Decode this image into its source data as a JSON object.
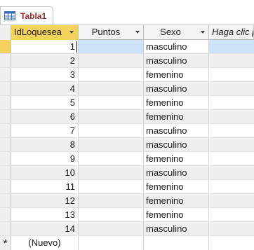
{
  "tab": {
    "title": "Tabla1",
    "icon": "table-icon"
  },
  "columns": [
    {
      "key": "id",
      "label": "IdLoquesea",
      "has_dropdown": true
    },
    {
      "key": "puntos",
      "label": "Puntos",
      "has_dropdown": true
    },
    {
      "key": "sexo",
      "label": "Sexo",
      "has_dropdown": true
    },
    {
      "key": "add",
      "label": "Haga clic p",
      "has_dropdown": false
    }
  ],
  "rows": [
    {
      "id": "1",
      "puntos": "",
      "sexo": "masculino"
    },
    {
      "id": "2",
      "puntos": "",
      "sexo": "masculino"
    },
    {
      "id": "3",
      "puntos": "",
      "sexo": "femenino"
    },
    {
      "id": "4",
      "puntos": "",
      "sexo": "masculino"
    },
    {
      "id": "5",
      "puntos": "",
      "sexo": "femenino"
    },
    {
      "id": "6",
      "puntos": "",
      "sexo": "femenino"
    },
    {
      "id": "7",
      "puntos": "",
      "sexo": "masculino"
    },
    {
      "id": "8",
      "puntos": "",
      "sexo": "masculino"
    },
    {
      "id": "9",
      "puntos": "",
      "sexo": "femenino"
    },
    {
      "id": "10",
      "puntos": "",
      "sexo": "masculino"
    },
    {
      "id": "11",
      "puntos": "",
      "sexo": "femenino"
    },
    {
      "id": "12",
      "puntos": "",
      "sexo": "femenino"
    },
    {
      "id": "13",
      "puntos": "",
      "sexo": "femenino"
    },
    {
      "id": "14",
      "puntos": "",
      "sexo": "masculino"
    }
  ],
  "new_row": {
    "marker": "*",
    "label": "(Nuevo)"
  },
  "colors": {
    "accent": "#f4d35d",
    "selection": "#cfe3f8",
    "tab_text": "#8e2a2a"
  }
}
